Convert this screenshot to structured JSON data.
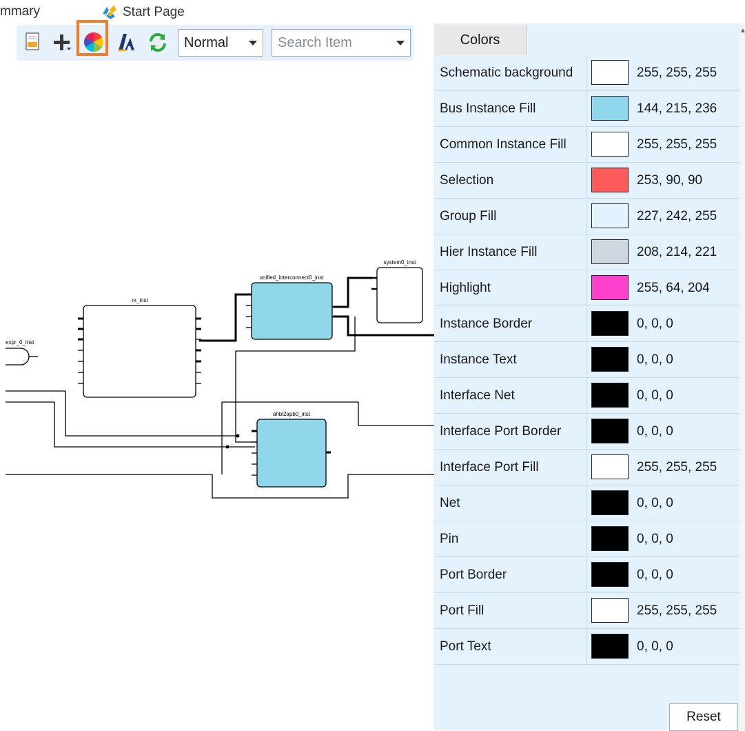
{
  "tabs": {
    "summary_label": "mmary",
    "start_page_label": "Start Page"
  },
  "toolbar": {
    "icons": [
      "page-icon",
      "add-icon",
      "color-wheel-icon",
      "text-style-icon",
      "refresh-icon"
    ],
    "view_mode": "Normal",
    "search_placeholder": "Search Item"
  },
  "schematic": {
    "instances": {
      "expr": "expr_0_inst",
      "rx": "rx_inst",
      "unified": "unified_interconnect0_inst",
      "system": "system0_inst",
      "ahbl": "ahbl2apb0_inst"
    },
    "bus_fill": "#90d7ec"
  },
  "colors_panel": {
    "tab_label": "Colors",
    "reset_label": "Reset",
    "rows": [
      {
        "name": "Schematic background",
        "rgb": "255, 255, 255",
        "hex": "#ffffff"
      },
      {
        "name": "Bus Instance Fill",
        "rgb": "144, 215, 236",
        "hex": "#90d7ec"
      },
      {
        "name": "Common Instance Fill",
        "rgb": "255, 255, 255",
        "hex": "#ffffff"
      },
      {
        "name": "Selection",
        "rgb": "253, 90, 90",
        "hex": "#fd5a5a"
      },
      {
        "name": "Group Fill",
        "rgb": "227, 242, 255",
        "hex": "#e3f2ff"
      },
      {
        "name": "Hier Instance Fill",
        "rgb": "208, 214, 221",
        "hex": "#d0d6dd"
      },
      {
        "name": "Highlight",
        "rgb": "255, 64, 204",
        "hex": "#ff40cc"
      },
      {
        "name": "Instance Border",
        "rgb": "0, 0, 0",
        "hex": "#000000"
      },
      {
        "name": "Instance Text",
        "rgb": "0, 0, 0",
        "hex": "#000000"
      },
      {
        "name": "Interface Net",
        "rgb": "0, 0, 0",
        "hex": "#000000"
      },
      {
        "name": "Interface Port Border",
        "rgb": "0, 0, 0",
        "hex": "#000000"
      },
      {
        "name": "Interface Port Fill",
        "rgb": "255, 255, 255",
        "hex": "#ffffff"
      },
      {
        "name": "Net",
        "rgb": "0, 0, 0",
        "hex": "#000000"
      },
      {
        "name": "Pin",
        "rgb": "0, 0, 0",
        "hex": "#000000"
      },
      {
        "name": "Port Border",
        "rgb": "0, 0, 0",
        "hex": "#000000"
      },
      {
        "name": "Port Fill",
        "rgb": "255, 255, 255",
        "hex": "#ffffff"
      },
      {
        "name": "Port Text",
        "rgb": "0, 0, 0",
        "hex": "#000000"
      }
    ]
  }
}
